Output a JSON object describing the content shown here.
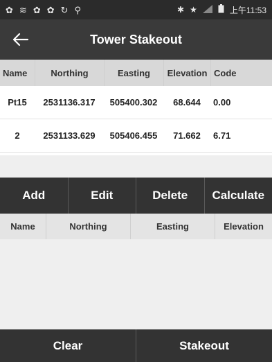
{
  "status_bar": {
    "left_icons": [
      "app-icon",
      "wifi-icon",
      "app-icon",
      "app-icon",
      "sync-icon",
      "location-icon"
    ],
    "right_icons": [
      "bluetooth-icon",
      "star-icon",
      "signal-icon",
      "battery-icon"
    ],
    "time": "上午11:53"
  },
  "header": {
    "title": "Tower Stakeout",
    "back_icon": "arrow-left-icon"
  },
  "points_table": {
    "columns": [
      "Name",
      "Northing",
      "Easting",
      "Elevation",
      "Code"
    ],
    "rows": [
      [
        "Pt15",
        "2531136.317",
        "505400.302",
        "68.644",
        "0.00"
      ],
      [
        "2",
        "2531133.629",
        "505406.455",
        "71.662",
        "6.71"
      ]
    ]
  },
  "actions": {
    "add": "Add",
    "edit": "Edit",
    "delete": "Delete",
    "calculate": "Calculate"
  },
  "results_table": {
    "columns": [
      "Name",
      "Northing",
      "Easting",
      "Elevation"
    ]
  },
  "footer": {
    "clear": "Clear",
    "stakeout": "Stakeout"
  },
  "colors": {
    "status_bar_bg": "#2b2b2b",
    "header_bg": "#3a3a3a",
    "table_header_bg": "#d8d8d8",
    "button_bar_bg": "#333333",
    "empty_area_bg": "#efefef"
  }
}
